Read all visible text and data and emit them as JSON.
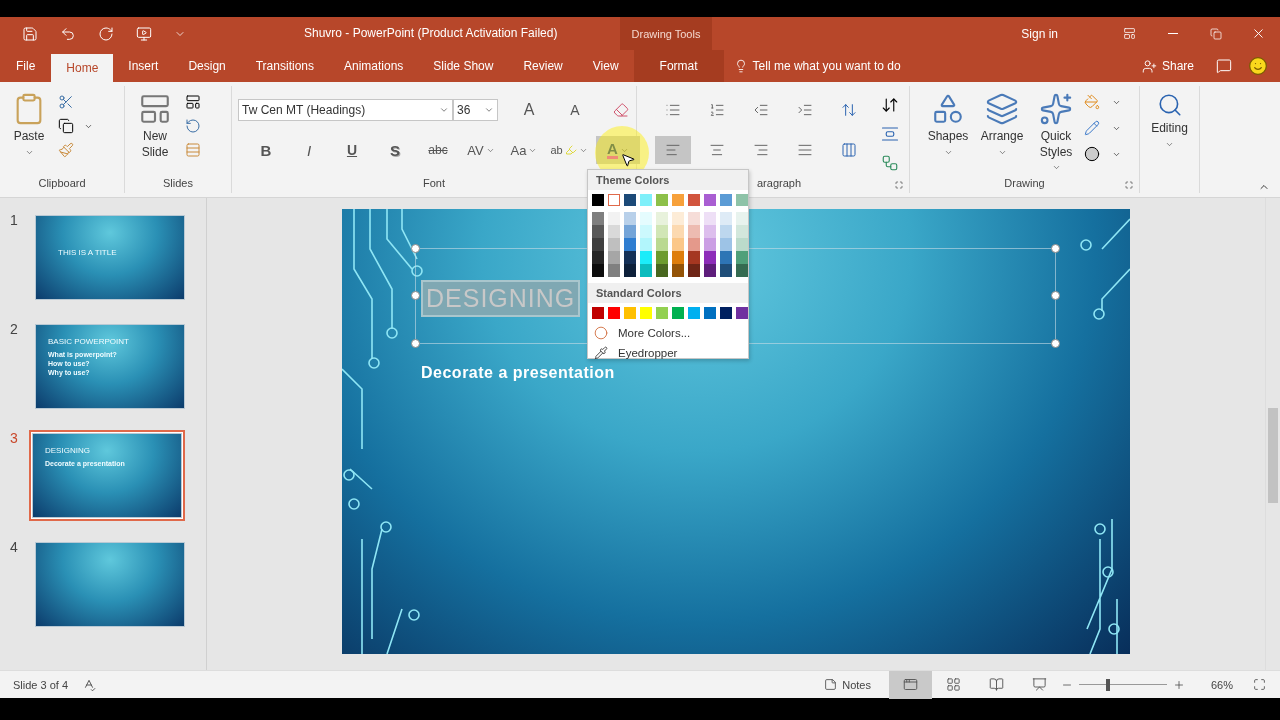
{
  "window": {
    "title": "Shuvro  -  PowerPoint (Product Activation Failed)",
    "context_header": "Drawing Tools",
    "sign_in": "Sign in"
  },
  "tabs": [
    {
      "label": "File",
      "kind": "normal",
      "selected": false
    },
    {
      "label": "Home",
      "kind": "normal",
      "selected": true
    },
    {
      "label": "Insert",
      "kind": "normal",
      "selected": false
    },
    {
      "label": "Design",
      "kind": "normal",
      "selected": false
    },
    {
      "label": "Transitions",
      "kind": "normal",
      "selected": false
    },
    {
      "label": "Animations",
      "kind": "normal",
      "selected": false
    },
    {
      "label": "Slide Show",
      "kind": "normal",
      "selected": false
    },
    {
      "label": "Review",
      "kind": "normal",
      "selected": false
    },
    {
      "label": "View",
      "kind": "normal",
      "selected": false
    },
    {
      "label": "Format",
      "kind": "contextual",
      "selected": false
    }
  ],
  "tell_me": {
    "placeholder": "Tell me what you want to do"
  },
  "share": "Share",
  "clipboard": {
    "label": "Clipboard",
    "paste": "Paste"
  },
  "slides_group": {
    "label": "Slides",
    "new_slide": "New Slide"
  },
  "font": {
    "label": "Font",
    "font_name": "Tw Cen MT (Headings)",
    "font_size": "36",
    "top_buttons": [
      {
        "kind": "grow",
        "label": "A"
      },
      {
        "kind": "shrink",
        "label": "A"
      }
    ],
    "buttons": [
      {
        "kind": "bold",
        "label": "B",
        "pressed": false
      },
      {
        "kind": "italic",
        "label": "I",
        "pressed": false
      },
      {
        "kind": "underline",
        "label": "U",
        "pressed": false
      },
      {
        "kind": "shadow",
        "label": "S",
        "pressed": false
      },
      {
        "kind": "strike",
        "label": "abc",
        "pressed": false
      },
      {
        "kind": "spacing",
        "label": "AV",
        "pressed": false
      },
      {
        "kind": "case",
        "label": "Aa",
        "pressed": false
      },
      {
        "kind": "highlight",
        "label": "ab",
        "pressed": false
      },
      {
        "kind": "color",
        "label": "A",
        "pressed": true
      }
    ]
  },
  "paragraph": {
    "label": "aragraph",
    "top_buttons": [
      {
        "kind": "bullets"
      },
      {
        "kind": "numbering"
      },
      {
        "kind": "outdent"
      },
      {
        "kind": "indent"
      },
      {
        "kind": "spacing"
      }
    ],
    "buttons": [
      {
        "kind": "left",
        "pressed": true
      },
      {
        "kind": "center",
        "pressed": false
      },
      {
        "kind": "right",
        "pressed": false
      },
      {
        "kind": "justify",
        "pressed": false
      },
      {
        "kind": "columns",
        "pressed": false
      }
    ]
  },
  "drawing": {
    "label": "Drawing",
    "buttons": [
      {
        "kind": "shapes",
        "label": "Shapes"
      },
      {
        "kind": "arrange",
        "label": "Arrange"
      },
      {
        "kind": "styles",
        "label": "Quick Styles"
      }
    ]
  },
  "editing": {
    "label": "Editing"
  },
  "thumbnails": [
    {
      "number": "1",
      "selected": false,
      "title": "THIS IS A TITLE"
    },
    {
      "number": "2",
      "selected": false,
      "title": "BASIC POWERPOINT",
      "lines": [
        "What is powerpoint?",
        "How to use?",
        "Why to use?"
      ]
    },
    {
      "number": "3",
      "selected": true,
      "title": "DESIGNING",
      "lines": [
        "Decorate a presentation"
      ]
    },
    {
      "number": "4",
      "selected": false
    }
  ],
  "slide": {
    "title": "DESIGNING",
    "title_selected": true,
    "subtitle": "Decorate a presentation"
  },
  "color_menu": {
    "theme_heading": "Theme Colors",
    "standard_heading": "Standard Colors",
    "theme": [
      {
        "color": "#000000",
        "selected": false,
        "shades": [
          {
            "color": "#7f7f7f"
          },
          {
            "color": "#595959"
          },
          {
            "color": "#3f3f3f"
          },
          {
            "color": "#262626"
          },
          {
            "color": "#0d0d0d"
          }
        ]
      },
      {
        "color": "#ffffff",
        "selected": true,
        "shades": [
          {
            "color": "#f2f2f2"
          },
          {
            "color": "#d9d9d9"
          },
          {
            "color": "#bfbfbf"
          },
          {
            "color": "#a6a6a6"
          },
          {
            "color": "#808080"
          }
        ]
      },
      {
        "color": "#1b4a78",
        "selected": false,
        "shades": [
          {
            "color": "#b8d0ea"
          },
          {
            "color": "#74a4d8"
          },
          {
            "color": "#2f7dd0"
          },
          {
            "color": "#143057"
          },
          {
            "color": "#0d203a"
          }
        ]
      },
      {
        "color": "#7ff0fa",
        "selected": false,
        "shades": [
          {
            "color": "#e5fcfe"
          },
          {
            "color": "#ccf9fd"
          },
          {
            "color": "#b2f6fc"
          },
          {
            "color": "#1cecf9"
          },
          {
            "color": "#0cbcbe"
          }
        ]
      },
      {
        "color": "#8dc049",
        "selected": false,
        "shades": [
          {
            "color": "#e8f2dc"
          },
          {
            "color": "#d1e6b6"
          },
          {
            "color": "#bad991"
          },
          {
            "color": "#6c9b2e"
          },
          {
            "color": "#48671f"
          }
        ]
      },
      {
        "color": "#f7a13b",
        "selected": false,
        "shades": [
          {
            "color": "#fdecd7"
          },
          {
            "color": "#fcd9b0"
          },
          {
            "color": "#fbc789"
          },
          {
            "color": "#de7d0b"
          },
          {
            "color": "#945307"
          }
        ]
      },
      {
        "color": "#d2553e",
        "selected": false,
        "shades": [
          {
            "color": "#f6ddd8"
          },
          {
            "color": "#edbbb1"
          },
          {
            "color": "#e4998b"
          },
          {
            "color": "#a53721"
          },
          {
            "color": "#6e2516"
          }
        ]
      },
      {
        "color": "#a95ed2",
        "selected": false,
        "shades": [
          {
            "color": "#eedff6"
          },
          {
            "color": "#ddbeed"
          },
          {
            "color": "#cb9ee4"
          },
          {
            "color": "#8d2cb9"
          },
          {
            "color": "#5e1d7b"
          }
        ]
      },
      {
        "color": "#5b9bd5",
        "selected": false,
        "shades": [
          {
            "color": "#deebf6"
          },
          {
            "color": "#bdd7ee"
          },
          {
            "color": "#9dc3e6"
          },
          {
            "color": "#2e75b5"
          },
          {
            "color": "#1f4e79"
          }
        ]
      },
      {
        "color": "#8ec3a8",
        "selected": false,
        "shades": [
          {
            "color": "#e8f3ee"
          },
          {
            "color": "#d2e7dc"
          },
          {
            "color": "#bbdbcb"
          },
          {
            "color": "#50a07a"
          },
          {
            "color": "#356b51"
          }
        ]
      }
    ],
    "standard": [
      {
        "color": "#c00000"
      },
      {
        "color": "#ff0000"
      },
      {
        "color": "#ffc000"
      },
      {
        "color": "#ffff00"
      },
      {
        "color": "#92d050"
      },
      {
        "color": "#00b050"
      },
      {
        "color": "#00b0f0"
      },
      {
        "color": "#0070c0"
      },
      {
        "color": "#002060"
      },
      {
        "color": "#7030a0"
      }
    ],
    "items": [
      {
        "kind": "more",
        "label": "More Colors..."
      },
      {
        "kind": "eyedropper",
        "label": "Eyedropper"
      }
    ]
  },
  "status": {
    "slide_info": "Slide 3 of 4",
    "notes": "Notes",
    "views": [
      {
        "kind": "normal",
        "selected": true
      },
      {
        "kind": "sorter",
        "selected": false
      },
      {
        "kind": "reading",
        "selected": false
      },
      {
        "kind": "show",
        "selected": false
      }
    ],
    "zoom": {
      "level": 0.31,
      "reading": "66%"
    }
  }
}
